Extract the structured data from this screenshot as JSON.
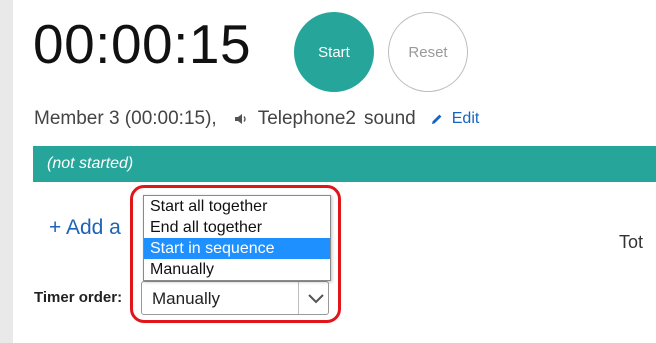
{
  "timer": {
    "display": "00:00:15"
  },
  "controls": {
    "start_label": "Start",
    "reset_label": "Reset"
  },
  "member": {
    "text": "Member 3 (00:00:15),",
    "sound_name": "Telephone2",
    "sound_label": "sound",
    "edit_label": "Edit"
  },
  "status": {
    "text": "(not started)"
  },
  "add_link": {
    "label": "+ Add a"
  },
  "total_label": "Tot",
  "timer_order": {
    "label": "Timer order:",
    "selected": "Manually",
    "options": [
      "Start all together",
      "End all together",
      "Start in sequence",
      "Manually"
    ],
    "highlighted_option": "Start in sequence"
  },
  "colors": {
    "accent": "#26a69a",
    "link": "#1e63b8",
    "dropdown_highlight": "#1e90ff",
    "annotation": "#e0161b"
  },
  "icons": {
    "speaker": "speaker-icon",
    "edit": "pencil-icon",
    "chevron": "chevron-down-icon"
  }
}
